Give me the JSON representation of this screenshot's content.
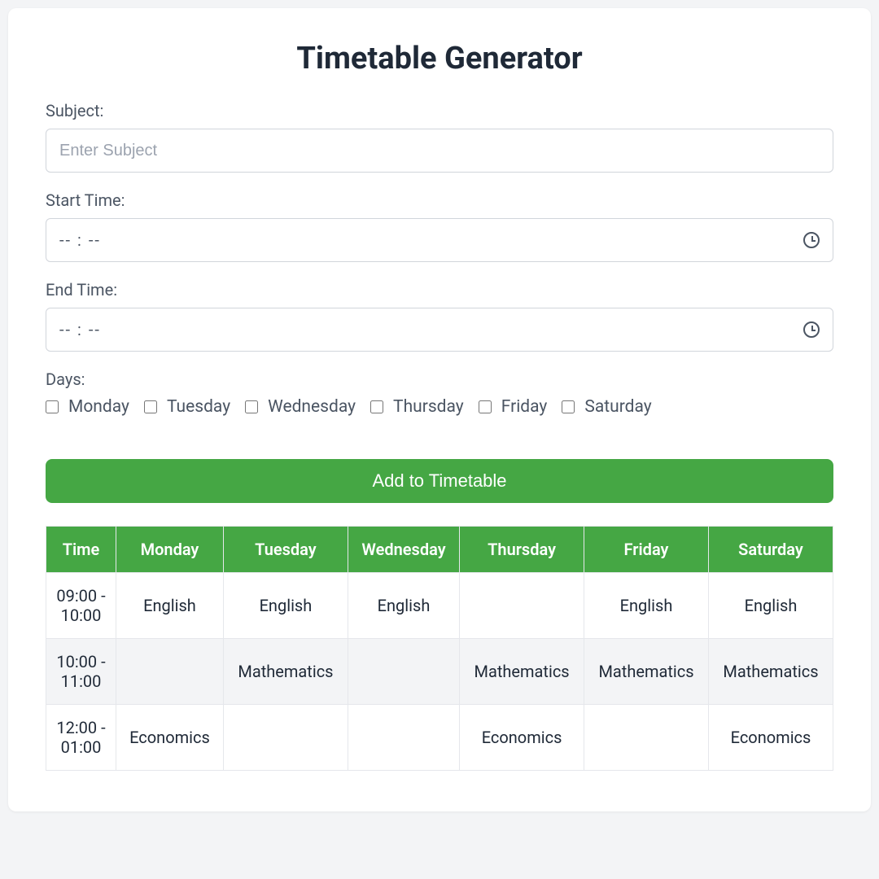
{
  "title": "Timetable Generator",
  "form": {
    "subject_label": "Subject:",
    "subject_placeholder": "Enter Subject",
    "start_time_label": "Start Time:",
    "end_time_label": "End Time:",
    "time_placeholder": "-- : --",
    "days_label": "Days:",
    "days": [
      "Monday",
      "Tuesday",
      "Wednesday",
      "Thursday",
      "Friday",
      "Saturday"
    ],
    "add_button": "Add to Timetable"
  },
  "table": {
    "headers": [
      "Time",
      "Monday",
      "Tuesday",
      "Wednesday",
      "Thursday",
      "Friday",
      "Saturday"
    ],
    "rows": [
      {
        "time": "09:00 - 10:00",
        "cells": [
          "English",
          "English",
          "English",
          "",
          "English",
          "English"
        ]
      },
      {
        "time": "10:00 - 11:00",
        "cells": [
          "",
          "Mathematics",
          "",
          "Mathematics",
          "Mathematics",
          "Mathematics"
        ]
      },
      {
        "time": "12:00 - 01:00",
        "cells": [
          "Economics",
          "",
          "",
          "Economics",
          "",
          "Economics"
        ]
      }
    ]
  }
}
